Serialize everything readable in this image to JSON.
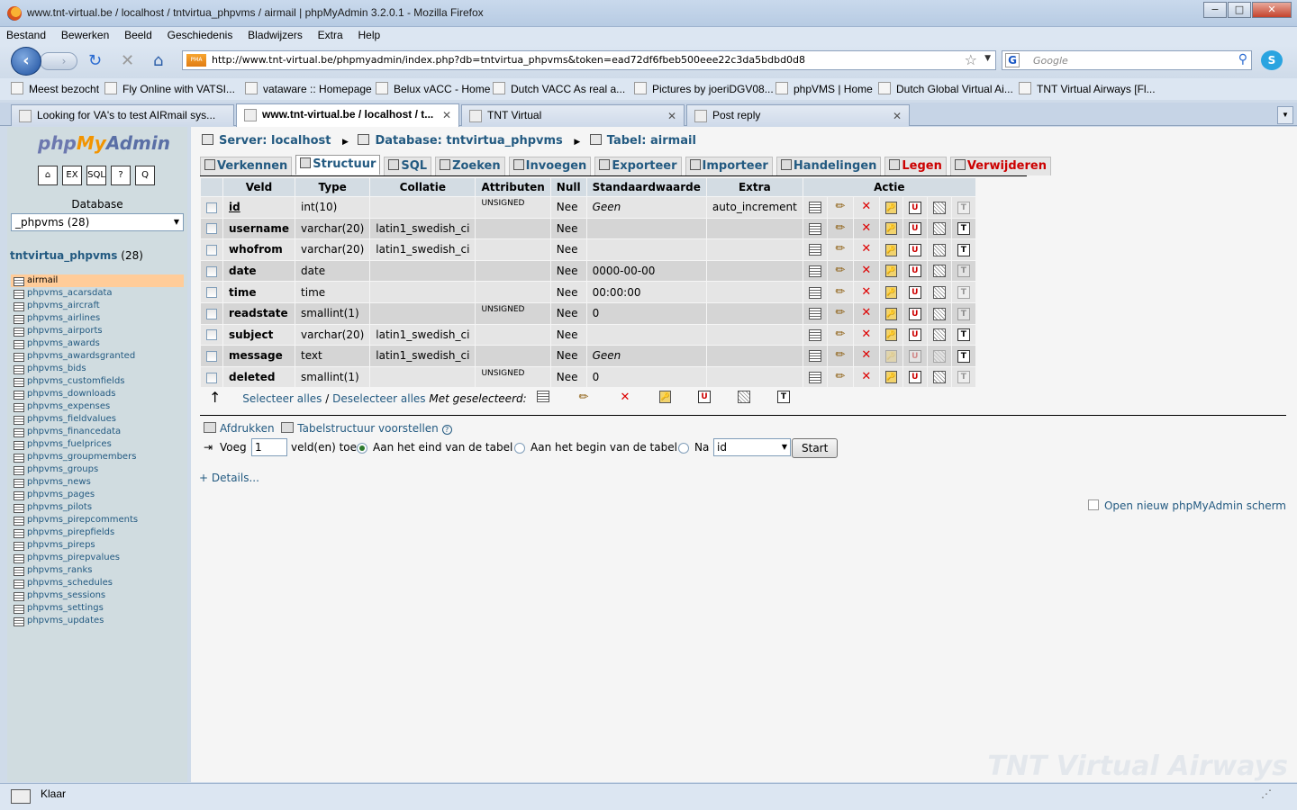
{
  "window": {
    "title": "www.tnt-virtual.be / localhost / tntvirtua_phpvms / airmail | phpMyAdmin 3.2.0.1 - Mozilla Firefox",
    "btn_min": "−",
    "btn_max": "□",
    "btn_close": "✕"
  },
  "menu": [
    "Bestand",
    "Bewerken",
    "Beeld",
    "Geschiedenis",
    "Bladwijzers",
    "Extra",
    "Help"
  ],
  "nav": {
    "url": "http://www.tnt-virtual.be/phpmyadmin/index.php?db=tntvirtua_phpvms&token=ead72df6fbeb500eee22c3da5bdbd0d8",
    "search_placeholder": "Google",
    "url_favicon_text": "PMA"
  },
  "bookmarks": [
    "Meest bezocht",
    "Fly Online with VATSI...",
    "vataware :: Homepage",
    "Belux vACC - Home",
    "Dutch VACC  As real a...",
    "Pictures by joeriDGV08...",
    "phpVMS | Home",
    "Dutch Global Virtual Ai...",
    "TNT Virtual Airways [Fl..."
  ],
  "tabs": [
    {
      "label": "Looking for VA's to test AIRmail sys...",
      "active": false
    },
    {
      "label": "www.tnt-virtual.be / localhost / t...",
      "active": true
    },
    {
      "label": "TNT Virtual",
      "active": false
    },
    {
      "label": "Post reply",
      "active": false
    }
  ],
  "sidebar": {
    "logo_php": "php",
    "logo_my": "My",
    "logo_admin": "Admin",
    "quick": [
      "⌂",
      "EX",
      "SQL",
      "?",
      "Q"
    ],
    "db_label": "Database",
    "db_select": "_phpvms (28)",
    "db_name": "tntvirtua_phpvms",
    "db_count": "(28)",
    "tables": [
      "airmail",
      "phpvms_acarsdata",
      "phpvms_aircraft",
      "phpvms_airlines",
      "phpvms_airports",
      "phpvms_awards",
      "phpvms_awardsgranted",
      "phpvms_bids",
      "phpvms_customfields",
      "phpvms_downloads",
      "phpvms_expenses",
      "phpvms_fieldvalues",
      "phpvms_financedata",
      "phpvms_fuelprices",
      "phpvms_groupmembers",
      "phpvms_groups",
      "phpvms_news",
      "phpvms_pages",
      "phpvms_pilots",
      "phpvms_pirepcomments",
      "phpvms_pirepfields",
      "phpvms_pireps",
      "phpvms_pirepvalues",
      "phpvms_ranks",
      "phpvms_schedules",
      "phpvms_sessions",
      "phpvms_settings",
      "phpvms_updates"
    ]
  },
  "breadcrumb": {
    "server": "Server: localhost",
    "database": "Database: tntvirtua_phpvms",
    "table": "Tabel: airmail"
  },
  "pma_tabs": [
    {
      "label": "Verkennen",
      "active": false,
      "red": false
    },
    {
      "label": "Structuur",
      "active": true,
      "red": false
    },
    {
      "label": "SQL",
      "active": false,
      "red": false
    },
    {
      "label": "Zoeken",
      "active": false,
      "red": false
    },
    {
      "label": "Invoegen",
      "active": false,
      "red": false
    },
    {
      "label": "Exporteer",
      "active": false,
      "red": false
    },
    {
      "label": "Importeer",
      "active": false,
      "red": false
    },
    {
      "label": "Handelingen",
      "active": false,
      "red": false
    },
    {
      "label": "Legen",
      "active": false,
      "red": true
    },
    {
      "label": "Verwijderen",
      "active": false,
      "red": true
    }
  ],
  "structure": {
    "headers": [
      "Veld",
      "Type",
      "Collatie",
      "Attributen",
      "Null",
      "Standaardwaarde",
      "Extra",
      "Actie"
    ],
    "rows": [
      {
        "field": "id",
        "type": "int(10)",
        "collation": "",
        "attributes": "UNSIGNED",
        "null": "Nee",
        "default": "Geen",
        "default_italic": true,
        "extra": "auto_increment",
        "pk": true,
        "dim": [
          0,
          0,
          0,
          0,
          0,
          0,
          1
        ]
      },
      {
        "field": "username",
        "type": "varchar(20)",
        "collation": "latin1_swedish_ci",
        "attributes": "",
        "null": "Nee",
        "default": "",
        "default_italic": false,
        "extra": "",
        "pk": false,
        "dim": [
          0,
          0,
          0,
          0,
          0,
          0,
          0
        ]
      },
      {
        "field": "whofrom",
        "type": "varchar(20)",
        "collation": "latin1_swedish_ci",
        "attributes": "",
        "null": "Nee",
        "default": "",
        "default_italic": false,
        "extra": "",
        "pk": false,
        "dim": [
          0,
          0,
          0,
          0,
          0,
          0,
          0
        ]
      },
      {
        "field": "date",
        "type": "date",
        "collation": "",
        "attributes": "",
        "null": "Nee",
        "default": "0000-00-00",
        "default_italic": false,
        "extra": "",
        "pk": false,
        "dim": [
          0,
          0,
          0,
          0,
          0,
          0,
          1
        ]
      },
      {
        "field": "time",
        "type": "time",
        "collation": "",
        "attributes": "",
        "null": "Nee",
        "default": "00:00:00",
        "default_italic": false,
        "extra": "",
        "pk": false,
        "dim": [
          0,
          0,
          0,
          0,
          0,
          0,
          1
        ]
      },
      {
        "field": "readstate",
        "type": "smallint(1)",
        "collation": "",
        "attributes": "UNSIGNED",
        "null": "Nee",
        "default": "0",
        "default_italic": false,
        "extra": "",
        "pk": false,
        "dim": [
          0,
          0,
          0,
          0,
          0,
          0,
          1
        ]
      },
      {
        "field": "subject",
        "type": "varchar(20)",
        "collation": "latin1_swedish_ci",
        "attributes": "",
        "null": "Nee",
        "default": "",
        "default_italic": false,
        "extra": "",
        "pk": false,
        "dim": [
          0,
          0,
          0,
          0,
          0,
          0,
          0
        ]
      },
      {
        "field": "message",
        "type": "text",
        "collation": "latin1_swedish_ci",
        "attributes": "",
        "null": "Nee",
        "default": "Geen",
        "default_italic": true,
        "extra": "",
        "pk": false,
        "dim": [
          0,
          0,
          0,
          1,
          1,
          1,
          0
        ]
      },
      {
        "field": "deleted",
        "type": "smallint(1)",
        "collation": "",
        "attributes": "UNSIGNED",
        "null": "Nee",
        "default": "0",
        "default_italic": false,
        "extra": "",
        "pk": false,
        "dim": [
          0,
          0,
          0,
          0,
          0,
          0,
          1
        ]
      }
    ],
    "action_icons": [
      "browse-icon",
      "edit-icon",
      "delete-icon",
      "primary-key-icon",
      "unique-icon",
      "index-icon",
      "fulltext-icon"
    ],
    "action_glyphs": [
      "",
      "✏",
      "✕",
      "🔑",
      "U",
      "",
      "T"
    ]
  },
  "selection": {
    "arrow": "↑",
    "select_all": "Selecteer alles",
    "slash": " / ",
    "deselect_all": "Deselecteer alles",
    "with_selected": "Met geselecteerd:"
  },
  "print_row": {
    "print": "Afdrukken",
    "propose": "Tabelstructuur voorstellen",
    "help": "?"
  },
  "add_row": {
    "label": "Voeg",
    "count": "1",
    "unit": "veld(en) toe",
    "opt_end": "Aan het eind van de tabel",
    "opt_begin": "Aan het begin van de tabel",
    "opt_after": "Na",
    "after_field": "id",
    "start": "Start"
  },
  "details": "+ Details...",
  "new_window": "Open nieuw phpMyAdmin scherm",
  "watermark": "TNT Virtual Airways",
  "status": "Klaar"
}
